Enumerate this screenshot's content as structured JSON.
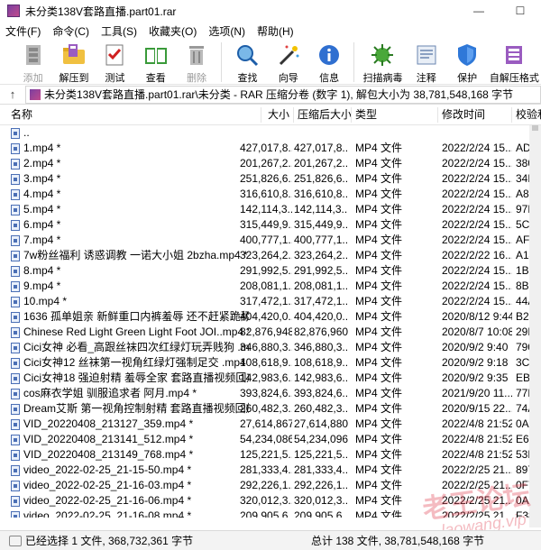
{
  "window": {
    "title": "未分类138V套路直播.part01.rar"
  },
  "menu": [
    "文件(F)",
    "命令(C)",
    "工具(S)",
    "收藏夹(O)",
    "选项(N)",
    "帮助(H)"
  ],
  "toolbar": {
    "items": [
      {
        "label": "添加",
        "icon": "add-icon",
        "disabled": true
      },
      {
        "label": "解压到",
        "icon": "extract-to-icon",
        "disabled": false
      },
      {
        "label": "测试",
        "icon": "test-icon",
        "disabled": false
      },
      {
        "label": "查看",
        "icon": "view-icon",
        "disabled": false
      },
      {
        "label": "删除",
        "icon": "delete-icon",
        "disabled": true
      },
      {
        "label": "查找",
        "icon": "find-icon",
        "disabled": false
      },
      {
        "label": "向导",
        "icon": "wizard-icon",
        "disabled": false
      },
      {
        "label": "信息",
        "icon": "info-icon",
        "disabled": false
      },
      {
        "label": "扫描病毒",
        "icon": "virus-scan-icon",
        "disabled": false
      },
      {
        "label": "注释",
        "icon": "comment-icon",
        "disabled": false
      },
      {
        "label": "保护",
        "icon": "protect-icon",
        "disabled": false
      },
      {
        "label": "自解压格式",
        "icon": "sfx-icon",
        "disabled": false
      }
    ]
  },
  "address": {
    "text": "未分类138V套路直播.part01.rar\\未分类 - RAR 压缩分卷 (数字 1), 解包大小为 38,781,548,168 字节"
  },
  "columns": [
    "名称",
    "大小",
    "压缩后大小",
    "类型",
    "修改时间",
    "校验和"
  ],
  "rows": [
    [
      "..",
      "",
      "",
      "",
      "",
      ""
    ],
    [
      "1.mp4 *",
      "427,017,8...",
      "427,017,8...",
      "MP4 文件",
      "2022/2/24 15...",
      "ADE03"
    ],
    [
      "2.mp4 *",
      "201,267,2...",
      "201,267,2...",
      "MP4 文件",
      "2022/2/24 15...",
      "38047"
    ],
    [
      "3.mp4 *",
      "251,826,6...",
      "251,826,6...",
      "MP4 文件",
      "2022/2/24 15...",
      "34F57"
    ],
    [
      "4.mp4 *",
      "316,610,8...",
      "316,610,8...",
      "MP4 文件",
      "2022/2/24 15...",
      "A86E1"
    ],
    [
      "5.mp4 *",
      "142,114,3...",
      "142,114,3...",
      "MP4 文件",
      "2022/2/24 15...",
      "97E57"
    ],
    [
      "6.mp4 *",
      "315,449,9...",
      "315,449,9...",
      "MP4 文件",
      "2022/2/24 15...",
      "5C5B6"
    ],
    [
      "7.mp4 *",
      "400,777,1...",
      "400,777,1...",
      "MP4 文件",
      "2022/2/24 15...",
      "AF89A"
    ],
    [
      "7w粉丝福利 诱惑调教 一诺大小姐 2bzha.mp4 *",
      "323,264,2...",
      "323,264,2...",
      "MP4 文件",
      "2022/2/22 16...",
      "A14B6"
    ],
    [
      "8.mp4 *",
      "291,992,5...",
      "291,992,5...",
      "MP4 文件",
      "2022/2/24 15...",
      "1B9EB"
    ],
    [
      "9.mp4 *",
      "208,081,1...",
      "208,081,1...",
      "MP4 文件",
      "2022/2/24 15...",
      "8B814"
    ],
    [
      "10.mp4 *",
      "317,472,1...",
      "317,472,1...",
      "MP4 文件",
      "2022/2/24 15...",
      "44AD7"
    ],
    [
      "1636 孤单姐亲 新鲜重口内裤羞辱 还不赶紧跪舔.mpo...",
      "404,420,0...",
      "404,420,0...",
      "MP4 文件",
      "2020/8/12 9:44",
      "B270F"
    ],
    [
      "Chinese Red Light Green Light Foot JOI..mp4 *",
      "82,876,948",
      "82,876,960",
      "MP4 文件",
      "2020/8/7 10:08",
      "29DFE"
    ],
    [
      "Cici女神 必看_高跟丝袜四次红绿灯玩弄贱狗 .mp4 *",
      "346,880,3...",
      "346,880,3...",
      "MP4 文件",
      "2020/9/2 9:40",
      "79086"
    ],
    [
      "Cici女神12 丝袜第一视角红绿灯强制足交 .mp4 *",
      "108,618,9...",
      "108,618,9...",
      "MP4 文件",
      "2020/9/2 9:18",
      "3C387"
    ],
    [
      "Cici女神18 强迫射精 羞辱全家 套路直播视频回放中...",
      "142,983,6...",
      "142,983,6...",
      "MP4 文件",
      "2020/9/2 9:35",
      "EB314"
    ],
    [
      "cos麻衣学姐 驯服追求者 阿月.mp4 *",
      "393,824,6...",
      "393,824,6...",
      "MP4 文件",
      "2021/9/20 11...",
      "77B1E"
    ],
    [
      "Dream艾斯 第一视角控制射精 套路直播视频回放 .m...",
      "260,482,3...",
      "260,482,3...",
      "MP4 文件",
      "2020/9/15 22...",
      "74A9B"
    ],
    [
      "VID_20220408_213127_359.mp4 *",
      "27,614,867",
      "27,614,880",
      "MP4 文件",
      "2022/4/8 21:52",
      "0ADE2"
    ],
    [
      "VID_20220408_213141_512.mp4 *",
      "54,234,086",
      "54,234,096",
      "MP4 文件",
      "2022/4/8 21:52",
      "E68EF"
    ],
    [
      "VID_20220408_213149_768.mp4 *",
      "125,221,5...",
      "125,221,5...",
      "MP4 文件",
      "2022/4/8 21:52",
      "53E2B"
    ],
    [
      "video_2022-02-25_21-15-50.mp4 *",
      "281,333,4...",
      "281,333,4...",
      "MP4 文件",
      "2022/2/25 21...",
      "89753"
    ],
    [
      "video_2022-02-25_21-16-03.mp4 *",
      "292,226,1...",
      "292,226,1...",
      "MP4 文件",
      "2022/2/25 21...",
      "0F712"
    ],
    [
      "video_2022-02-25_21-16-06.mp4 *",
      "320,012,3...",
      "320,012,3...",
      "MP4 文件",
      "2022/2/25 21...",
      "0A082"
    ],
    [
      "video_2022-02-25_21-16-08.mp4 *",
      "209,905,6...",
      "209,905,6...",
      "MP4 文件",
      "2022/2/25 21...",
      "F3837"
    ],
    [
      "video_2022-02-25_21-16-11.mp4 *",
      "188,288,3...",
      "188,288,3...",
      "MP4 文件",
      "2022/2/25 21...",
      "3DF7E"
    ]
  ],
  "status": {
    "left": "已经选择 1 文件, 368,732,361 字节",
    "right": "总计 138 文件, 38,781,548,168 字节"
  },
  "watermark": {
    "line1": "老王论坛",
    "line2": "laowang.vip"
  }
}
